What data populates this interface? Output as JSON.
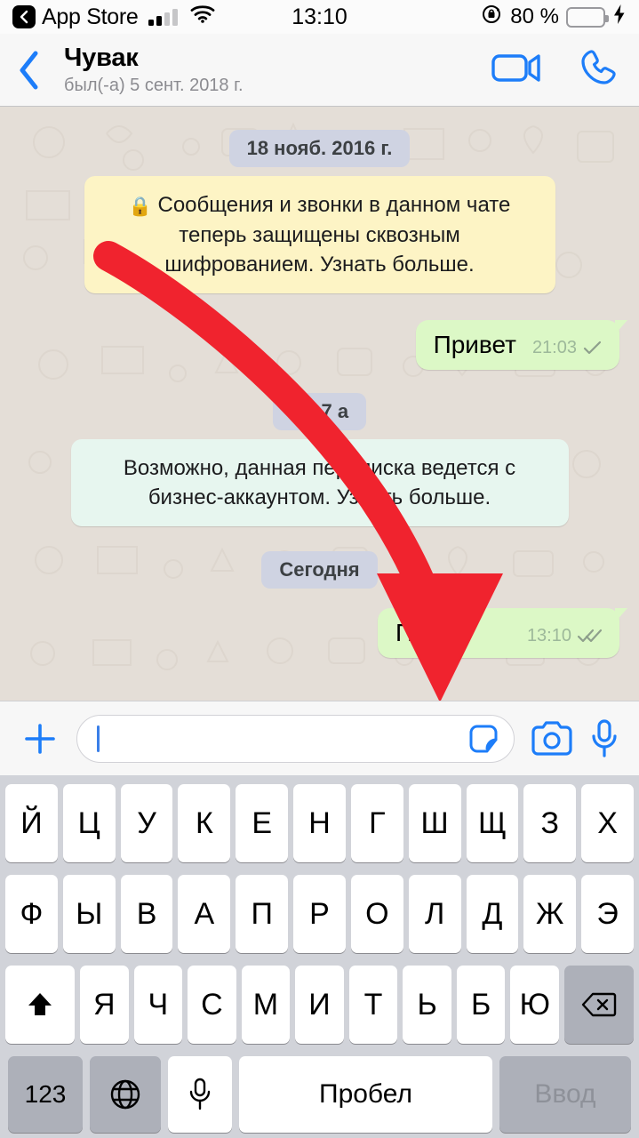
{
  "status_bar": {
    "back_app_label": "App Store",
    "time": "13:10",
    "battery_percent": "80 %",
    "battery_level": 80,
    "signal_bars_active": 2,
    "icons": [
      "back-chevron-icon",
      "cellular-signal-icon",
      "wifi-icon",
      "rotation-lock-icon",
      "battery-icon",
      "charging-bolt-icon"
    ]
  },
  "nav": {
    "contact_name": "Чувак",
    "last_seen": "был(-а) 5 сент. 2018 г.",
    "back_label": "back",
    "video_call_label": "video-call",
    "voice_call_label": "voice-call"
  },
  "chat": {
    "date_1": "18 нояб. 2016 г.",
    "encryption_notice": "Сообщения и звонки в данном чате теперь защищены сквозным шифрованием. Узнать больше.",
    "lock_glyph": "🔒",
    "message_1": {
      "text": "Привет",
      "time": "21:03",
      "status": "sent"
    },
    "date_2": "вт, 7 а",
    "business_notice": "Возможно, данная переписка ведется с бизнес-аккаунтом. Узнать больше.",
    "date_3": "Сегодня",
    "message_2": {
      "text": "Пр",
      "time": "13:10",
      "status": "delivered"
    }
  },
  "input_bar": {
    "text_value": "",
    "placeholder": "",
    "attach_label": "+",
    "icons": [
      "plus-icon",
      "sticker-icon",
      "camera-icon",
      "microphone-icon"
    ]
  },
  "keyboard": {
    "row1": [
      "Й",
      "Ц",
      "У",
      "К",
      "Е",
      "Н",
      "Г",
      "Ш",
      "Щ",
      "З",
      "Х"
    ],
    "row2": [
      "Ф",
      "Ы",
      "В",
      "А",
      "П",
      "Р",
      "О",
      "Л",
      "Д",
      "Ж",
      "Э"
    ],
    "row3": [
      "Я",
      "Ч",
      "С",
      "М",
      "И",
      "Т",
      "Ь",
      "Б",
      "Ю"
    ],
    "shift_label": "shift",
    "backspace_label": "backspace",
    "numbers_key": "123",
    "globe_key": "globe",
    "dictation_key": "microphone",
    "space_key": "Пробел",
    "enter_key": "Ввод"
  },
  "annotation": {
    "type": "red-curved-arrow",
    "points_to": "sticker-icon",
    "color": "#f0232e"
  },
  "colors": {
    "accent_blue": "#1d7df9",
    "outgoing_bubble": "#dcf8c6",
    "system_yellow": "#fdf4c5",
    "system_green": "#e7f6ef",
    "date_pill": "#cfd3e2",
    "chat_bg": "#e4ded7",
    "keyboard_bg": "#d1d3d9",
    "arrow_red": "#f0232e"
  }
}
